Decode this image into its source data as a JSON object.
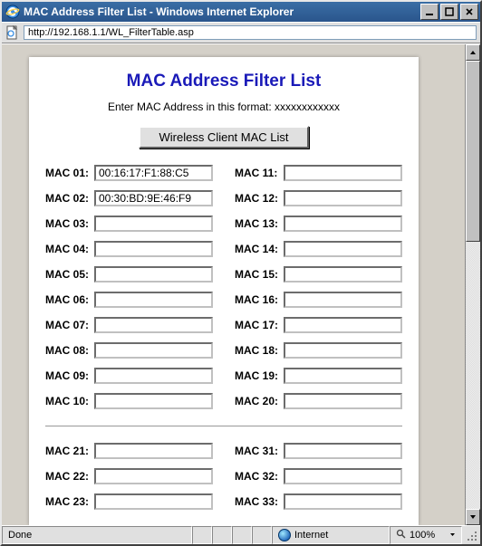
{
  "window": {
    "title": "MAC Address Filter List - Windows Internet Explorer"
  },
  "address_bar": {
    "url": "http://192.168.1.1/WL_FilterTable.asp"
  },
  "page": {
    "title": "MAC Address Filter List",
    "subtitle": "Enter MAC Address in this format: xxxxxxxxxxxx",
    "client_list_button": "Wireless Client MAC List"
  },
  "mac_block_a_left": [
    {
      "label": "MAC 01:",
      "value": "00:16:17:F1:88:C5"
    },
    {
      "label": "MAC 02:",
      "value": "00:30:BD:9E:46:F9"
    },
    {
      "label": "MAC 03:",
      "value": ""
    },
    {
      "label": "MAC 04:",
      "value": ""
    },
    {
      "label": "MAC 05:",
      "value": ""
    },
    {
      "label": "MAC 06:",
      "value": ""
    },
    {
      "label": "MAC 07:",
      "value": ""
    },
    {
      "label": "MAC 08:",
      "value": ""
    },
    {
      "label": "MAC 09:",
      "value": ""
    },
    {
      "label": "MAC 10:",
      "value": ""
    }
  ],
  "mac_block_a_right": [
    {
      "label": "MAC 11:",
      "value": ""
    },
    {
      "label": "MAC 12:",
      "value": ""
    },
    {
      "label": "MAC 13:",
      "value": ""
    },
    {
      "label": "MAC 14:",
      "value": ""
    },
    {
      "label": "MAC 15:",
      "value": ""
    },
    {
      "label": "MAC 16:",
      "value": ""
    },
    {
      "label": "MAC 17:",
      "value": ""
    },
    {
      "label": "MAC 18:",
      "value": ""
    },
    {
      "label": "MAC 19:",
      "value": ""
    },
    {
      "label": "MAC 20:",
      "value": ""
    }
  ],
  "mac_block_b_left": [
    {
      "label": "MAC 21:",
      "value": ""
    },
    {
      "label": "MAC 22:",
      "value": ""
    },
    {
      "label": "MAC 23:",
      "value": ""
    }
  ],
  "mac_block_b_right": [
    {
      "label": "MAC 31:",
      "value": ""
    },
    {
      "label": "MAC 32:",
      "value": ""
    },
    {
      "label": "MAC 33:",
      "value": ""
    }
  ],
  "statusbar": {
    "status_text": "Done",
    "zone_text": "Internet",
    "zoom_text": "100%"
  }
}
